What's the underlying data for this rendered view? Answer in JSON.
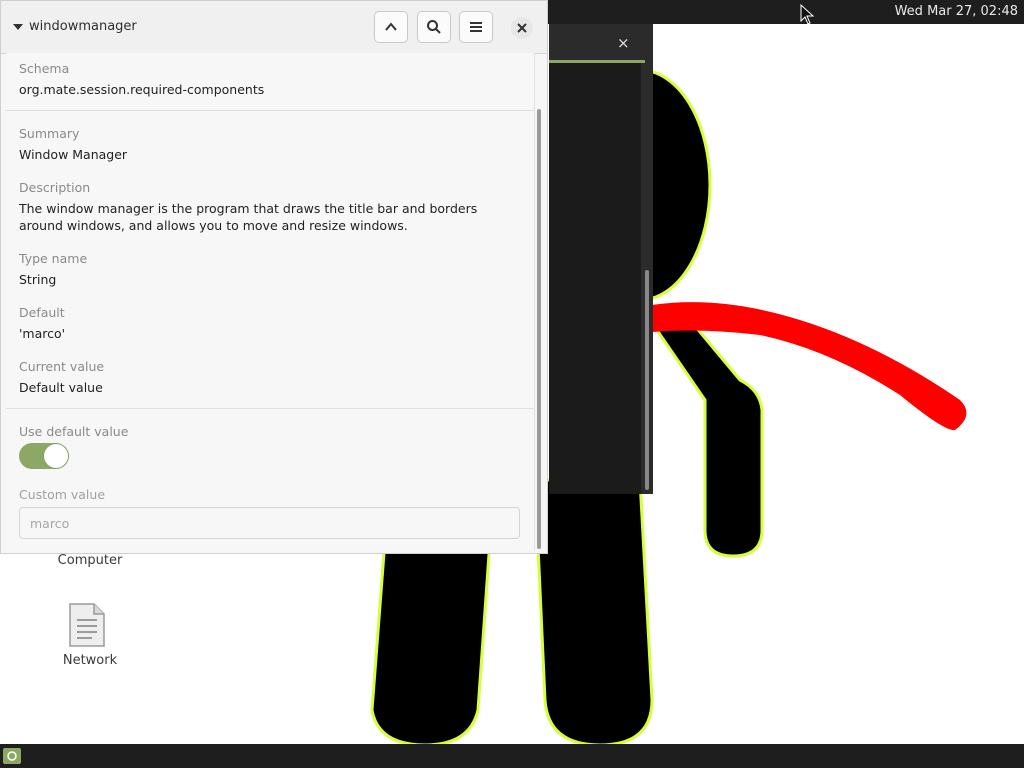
{
  "top_panel": {
    "clock": "Wed Mar 27, 02:48"
  },
  "background_window": {
    "close_glyph": "×"
  },
  "desktop": {
    "icons": [
      {
        "label": "Computer",
        "icon": "computer-icon"
      },
      {
        "label": "Network",
        "icon": "network-file-icon"
      }
    ]
  },
  "window": {
    "title": "windowmanager",
    "buttons": {
      "up": "chevron-up-icon",
      "search": "search-icon",
      "menu": "hamburger-menu-icon",
      "close": "close-icon"
    },
    "fields": {
      "schema_label": "Schema",
      "schema_value": "org.mate.session.required-components",
      "summary_label": "Summary",
      "summary_value": "Window Manager",
      "description_label": "Description",
      "description_value": "The window manager is the program that draws the title bar and borders around windows, and allows you to move and resize windows.",
      "type_label": "Type name",
      "type_value": "String",
      "default_label": "Default",
      "default_value": "'marco'",
      "current_label": "Current value",
      "current_value": "Default value",
      "use_default_label": "Use default value",
      "use_default_on": true,
      "custom_label": "Custom value",
      "custom_value": "marco"
    }
  },
  "colors": {
    "accent": "#8ca864",
    "panel": "#1e1e1e"
  }
}
